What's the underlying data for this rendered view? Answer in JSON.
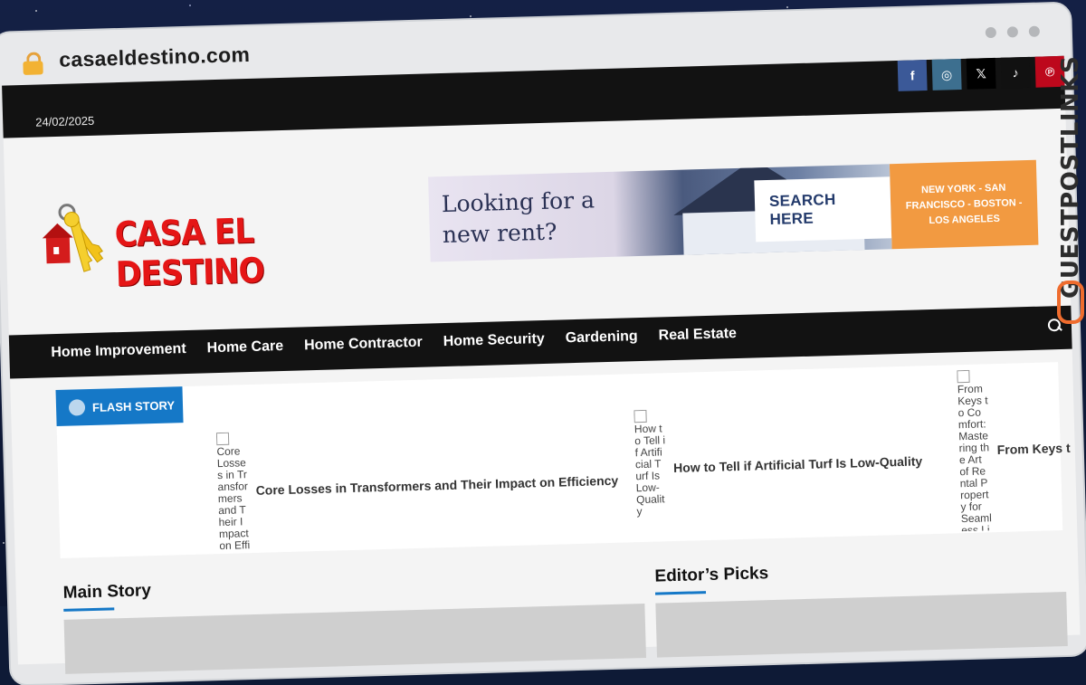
{
  "browser": {
    "url": "casaeldestino.com"
  },
  "topbar": {
    "date": "24/02/2025",
    "social": [
      {
        "name": "facebook-icon",
        "glyph": "f"
      },
      {
        "name": "instagram-icon",
        "glyph": "◎"
      },
      {
        "name": "x-icon",
        "glyph": "𝕏"
      },
      {
        "name": "tiktok-icon",
        "glyph": "♪"
      },
      {
        "name": "pinterest-icon",
        "glyph": "℗"
      }
    ]
  },
  "header": {
    "logo_text": "CASA EL DESTINO",
    "banner": {
      "tagline": "Looking for a new rent?",
      "cta": "SEARCH HERE",
      "cities": "NEW YORK - SAN FRANCISCO - BOSTON - LOS ANGELES"
    }
  },
  "nav": {
    "items": [
      "Home Improvement",
      "Home Care",
      "Home Contractor",
      "Home Security",
      "Gardening",
      "Real Estate"
    ]
  },
  "flash": {
    "badge": "FLASH STORY",
    "items": [
      {
        "alt": "Core Losses in Transformers and Their Impact on Efficiency",
        "title": "Core Losses in Transformers and Their Impact on Efficiency"
      },
      {
        "alt": "How to Tell if Artificial Turf Is Low-Quality",
        "title": "How to Tell if Artificial Turf Is Low-Quality"
      },
      {
        "alt": "From Keys to Comfort: Mastering the Art of Rental Property for Seamless Living",
        "title": "From Keys t"
      }
    ]
  },
  "sections": {
    "main_story": "Main Story",
    "editors_picks": "Editor’s Picks"
  },
  "watermark": "GUESTPOSTLINKS",
  "colors": {
    "accent": "#1578c7",
    "nav_bg": "#121212",
    "logo_red": "#e51616",
    "banner_orange": "#f29a41"
  }
}
